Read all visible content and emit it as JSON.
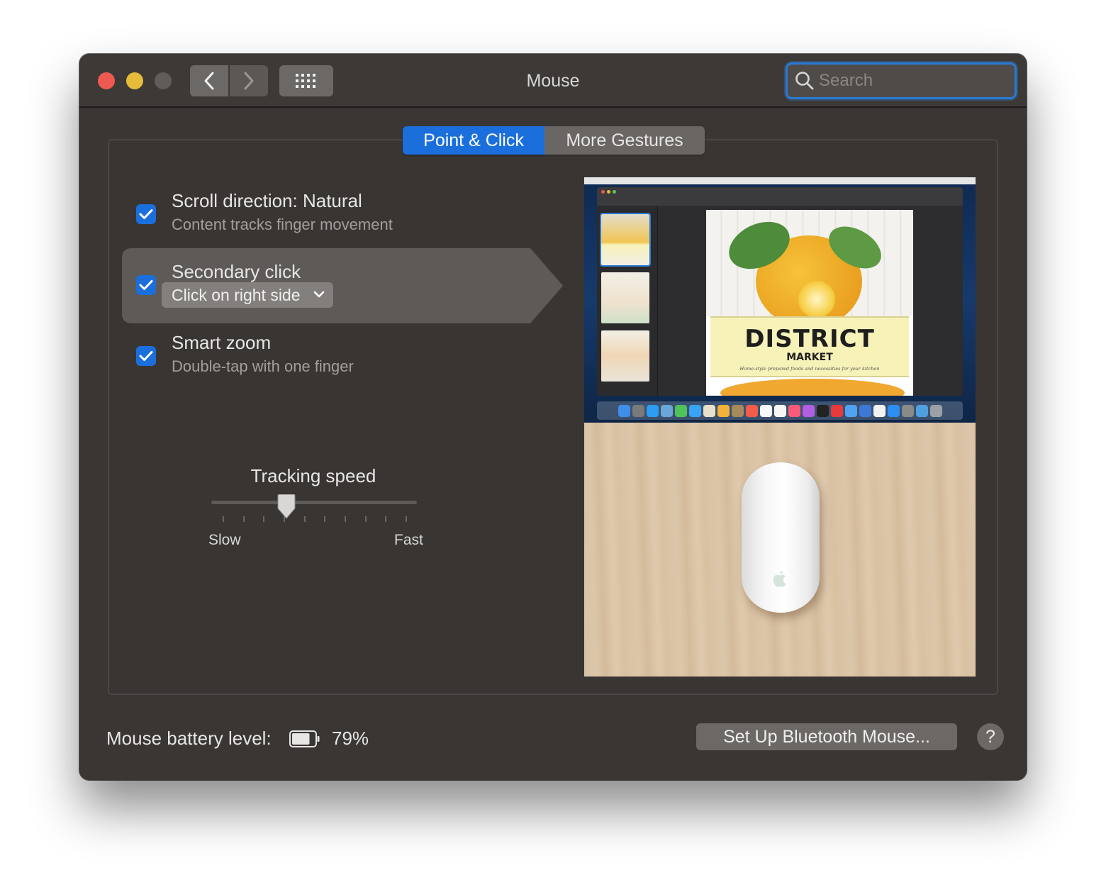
{
  "window": {
    "title": "Mouse",
    "search_placeholder": "Search"
  },
  "tabs": [
    {
      "label": "Point & Click",
      "active": true
    },
    {
      "label": "More Gestures",
      "active": false
    }
  ],
  "options": [
    {
      "title": "Scroll direction: Natural",
      "subtitle": "Content tracks finger movement",
      "checked": true
    },
    {
      "title": "Secondary click",
      "dropdown_value": "Click on right side",
      "checked": true,
      "selected": true
    },
    {
      "title": "Smart zoom",
      "subtitle": "Double-tap with one finger",
      "checked": true
    }
  ],
  "tracking": {
    "label": "Tracking speed",
    "min_label": "Slow",
    "max_label": "Fast",
    "level": 0.35,
    "ticks": 10
  },
  "preview": {
    "doc_title": "DISTRICT",
    "doc_subtitle": "MARKET",
    "doc_tagline": "Home-style prepared foods and necessities for your kitchen"
  },
  "footer": {
    "battery_label": "Mouse battery level:",
    "battery_percent": "79%",
    "battery_level": 0.79,
    "bluetooth_button": "Set Up Bluetooth Mouse...",
    "help_label": "?"
  },
  "colors": {
    "accent": "#1b6fdc",
    "window_bg": "#3a3634",
    "close": "#ee5a52",
    "minimize": "#e6bc3a"
  }
}
